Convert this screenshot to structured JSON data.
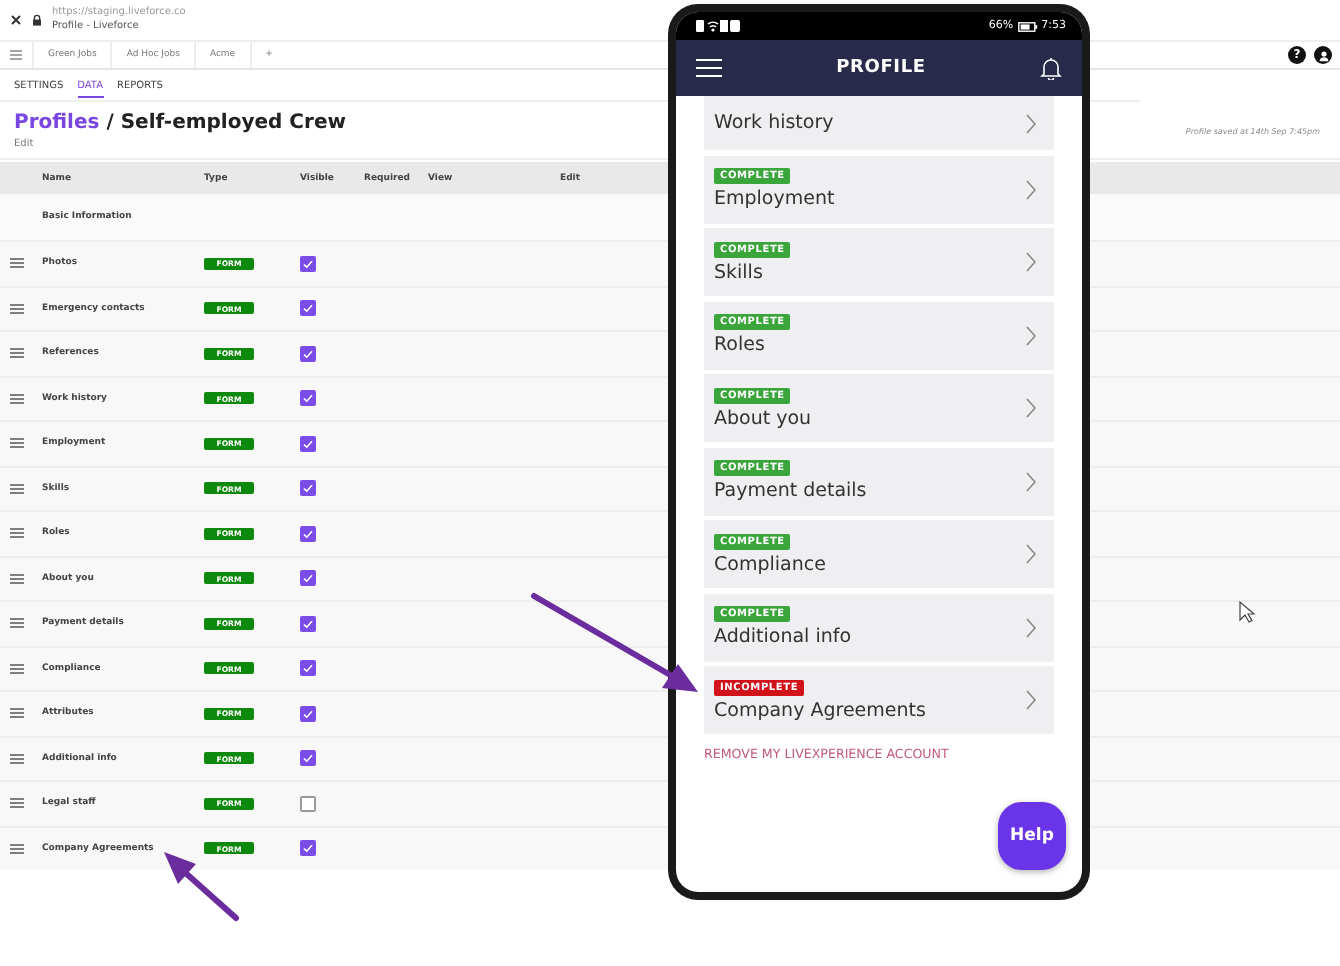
{
  "browser": {
    "url": "https://staging.liveforce.co",
    "title": "Profile - Liveforce"
  },
  "app_tabs": [
    "Green Jobs",
    "Ad Hoc Jobs",
    "Acme",
    "+"
  ],
  "help_glyph": "?",
  "nav_tabs": [
    {
      "label": "SETTINGS",
      "selected": false
    },
    {
      "label": "DATA",
      "selected": true
    },
    {
      "label": "REPORTS",
      "selected": false
    }
  ],
  "breadcrumb": {
    "link": "Profiles",
    "separator": "/",
    "current": "Self-employed Crew"
  },
  "edit_link": "Edit",
  "saved_note": "Profile saved at 14th Sep 7:45pm",
  "table": {
    "columns": [
      "Name",
      "Type",
      "Visible",
      "Required",
      "View",
      "Edit"
    ],
    "section": "Basic Information",
    "rows": [
      {
        "name": "Photos",
        "type": "FORM",
        "visible": true
      },
      {
        "name": "Emergency contacts",
        "type": "FORM",
        "visible": true
      },
      {
        "name": "References",
        "type": "FORM",
        "visible": true
      },
      {
        "name": "Work history",
        "type": "FORM",
        "visible": true
      },
      {
        "name": "Employment",
        "type": "FORM",
        "visible": true
      },
      {
        "name": "Skills",
        "type": "FORM",
        "visible": true
      },
      {
        "name": "Roles",
        "type": "FORM",
        "visible": true
      },
      {
        "name": "About you",
        "type": "FORM",
        "visible": true
      },
      {
        "name": "Payment details",
        "type": "FORM",
        "visible": true
      },
      {
        "name": "Compliance",
        "type": "FORM",
        "visible": true
      },
      {
        "name": "Attributes",
        "type": "FORM",
        "visible": true
      },
      {
        "name": "Additional info",
        "type": "FORM",
        "visible": true
      },
      {
        "name": "Legal staff",
        "type": "FORM",
        "visible": false
      },
      {
        "name": "Company Agreements",
        "type": "FORM",
        "visible": true
      }
    ]
  },
  "phone": {
    "status_bar": {
      "battery": "66%",
      "time": "7:53"
    },
    "title": "PROFILE",
    "items": [
      {
        "label": "Work history"
      },
      {
        "label": "Employment",
        "badge": "COMPLETE",
        "kind": "complete"
      },
      {
        "label": "Skills",
        "badge": "COMPLETE",
        "kind": "complete"
      },
      {
        "label": "Roles",
        "badge": "COMPLETE",
        "kind": "complete"
      },
      {
        "label": "About you",
        "badge": "COMPLETE",
        "kind": "complete"
      },
      {
        "label": "Payment details",
        "badge": "COMPLETE",
        "kind": "complete"
      },
      {
        "label": "Compliance",
        "badge": "COMPLETE",
        "kind": "complete"
      },
      {
        "label": "Additional info",
        "badge": "COMPLETE",
        "kind": "complete"
      },
      {
        "label": "Company Agreements",
        "badge": "INCOMPLETE",
        "kind": "incomplete"
      }
    ],
    "remove_link": "REMOVE MY LIVEXPERIENCE ACCOUNT",
    "help_button": "Help"
  }
}
